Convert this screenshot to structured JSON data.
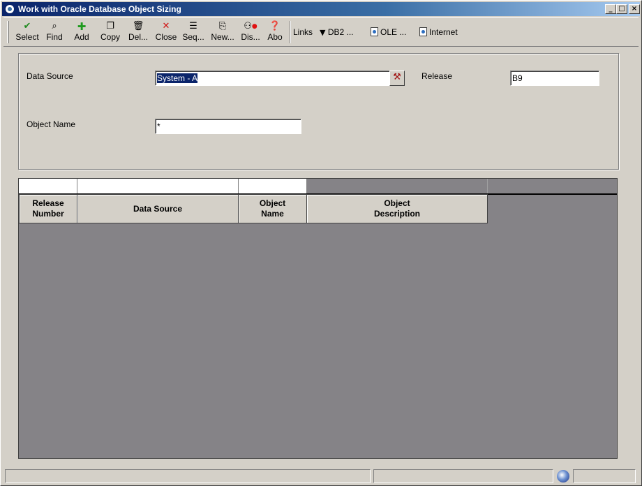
{
  "window": {
    "title": "Work with Oracle Database Object Sizing"
  },
  "toolbar": {
    "buttons": [
      {
        "id": "select",
        "label": "Select",
        "icon": "checkmark-icon",
        "color": "#1f8a1f"
      },
      {
        "id": "find",
        "label": "Find",
        "icon": "find-icon"
      },
      {
        "id": "add",
        "label": "Add",
        "icon": "plus-icon",
        "color": "#1f9a1f"
      },
      {
        "id": "copy",
        "label": "Copy",
        "icon": "copy-icon"
      },
      {
        "id": "delete",
        "label": "Del...",
        "icon": "trash-icon"
      },
      {
        "id": "close",
        "label": "Close",
        "icon": "x-icon",
        "color": "#d01010"
      },
      {
        "id": "seq",
        "label": "Seq...",
        "icon": "sequence-icon"
      },
      {
        "id": "new",
        "label": "New...",
        "icon": "new-icon"
      },
      {
        "id": "display",
        "label": "Dis...",
        "icon": "display-icon"
      },
      {
        "id": "about",
        "label": "Abo",
        "icon": "help-icon"
      }
    ],
    "links_label": "Links",
    "db2_label": "DB2 ...",
    "ole_label": "OLE ...",
    "internet_label": "Internet"
  },
  "form": {
    "data_source_label": "Data Source",
    "data_source_value": "System - A",
    "release_label": "Release",
    "release_value": "B9",
    "object_name_label": "Object Name",
    "object_name_value": "*"
  },
  "grid": {
    "columns": [
      {
        "label": "Release\nNumber"
      },
      {
        "label": "Data Source"
      },
      {
        "label": "Object\nName"
      },
      {
        "label": "Object\nDescription"
      }
    ],
    "rows": []
  },
  "colors": {
    "titlebar_start": "#0a246a",
    "window_bg": "#d4d0c8",
    "grid_bg": "#858387"
  }
}
